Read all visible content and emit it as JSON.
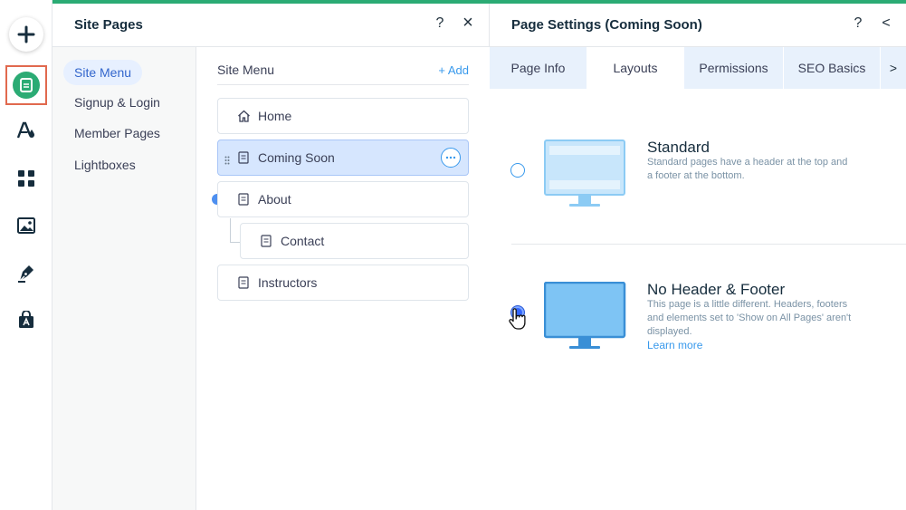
{
  "colors": {
    "brand_green": "#2bab74",
    "accent_blue": "#3899ec",
    "selected_row": "#d6e6fe",
    "highlight_frame": "#e1694e"
  },
  "toolbar": {
    "items": [
      {
        "name": "add",
        "icon": "plus-icon"
      },
      {
        "name": "pages",
        "icon": "page-icon",
        "active": true
      },
      {
        "name": "theme",
        "icon": "theme-icon"
      },
      {
        "name": "apps",
        "icon": "apps-grid-icon"
      },
      {
        "name": "media",
        "icon": "image-icon"
      },
      {
        "name": "blog",
        "icon": "pen-nib-icon"
      },
      {
        "name": "store",
        "icon": "bag-icon"
      }
    ]
  },
  "site_pages": {
    "title": "Site Pages",
    "help": "?",
    "close": "×",
    "nav": [
      "Site Menu",
      "Signup & Login",
      "Member Pages",
      "Lightboxes"
    ],
    "menu_title": "Site Menu",
    "add_label": "+ Add",
    "pages": [
      {
        "label": "Home",
        "icon": "home-icon"
      },
      {
        "label": "Coming Soon",
        "icon": "page-icon",
        "selected": true
      },
      {
        "label": "About",
        "icon": "page-icon"
      },
      {
        "label": "Contact",
        "icon": "page-icon",
        "subpage": true
      },
      {
        "label": "Instructors",
        "icon": "page-icon"
      }
    ]
  },
  "page_settings": {
    "title": "Page Settings (Coming Soon)",
    "help": "?",
    "back": "<",
    "tabs": [
      "Page Info",
      "Layouts",
      "Permissions",
      "SEO Basics"
    ],
    "active_tab": "Layouts",
    "more_tabs": ">",
    "layouts": [
      {
        "title": "Standard",
        "description": "Standard pages have a header at the top and a footer at the bottom.",
        "selected": false
      },
      {
        "title": "No Header & Footer",
        "description": "This page is a little different. Headers, footers and elements set to 'Show on All Pages' aren't displayed.",
        "link": "Learn more",
        "selected": true
      }
    ]
  }
}
